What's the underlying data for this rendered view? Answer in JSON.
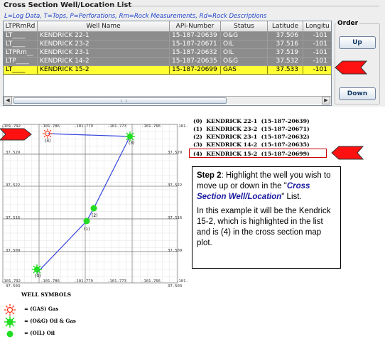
{
  "panel": {
    "title": "Cross Section Well/Location List",
    "legend": "L=Log Data, T=Tops, P=Perforations, Rm=Rock Measurements, Rd=Rock Descriptions"
  },
  "table": {
    "columns": [
      "LTPRmRd",
      "Well Name",
      "API-Number",
      "Status",
      "Latitude",
      "Longitu"
    ],
    "rows": [
      {
        "flags": "LT____",
        "name": "KENDRICK 22-1",
        "api": "15-187-20639",
        "status": "O&G",
        "lat": "37.506",
        "lon": "-101"
      },
      {
        "flags": "LT____",
        "name": "KENDRICK 23-2",
        "api": "15-187-20671",
        "status": "OIL",
        "lat": "37.516",
        "lon": "-101"
      },
      {
        "flags": "LTPRm__",
        "name": "KENDRICK 23-1",
        "api": "15-187-20632",
        "status": "OIL",
        "lat": "37.519",
        "lon": "-101"
      },
      {
        "flags": "LTP____",
        "name": "KENDRICK 14-2",
        "api": "15-187-20635",
        "status": "O&G",
        "lat": "37.532",
        "lon": "-101"
      },
      {
        "flags": "LT____",
        "name": "KENDRICK 15-2",
        "api": "15-187-20699",
        "status": "GAS",
        "lat": "37.533",
        "lon": "-101"
      }
    ],
    "selected_index": 4,
    "colors": {
      "row_bg": "#8c8c8c",
      "selected_bg": "#ffff33"
    }
  },
  "order": {
    "label": "Order",
    "up": "Up",
    "down": "Down"
  },
  "scroll": {
    "left_arrow": "◀",
    "right_arrow": "▶",
    "grip": "|||"
  },
  "plot": {
    "top_ticks": [
      "-101.792",
      "-101.786",
      "-101.779",
      "-101.773",
      "-101.766",
      "-101.76"
    ],
    "bottom_ticks": [
      "-101.792",
      "-101.786",
      "-101.779",
      "-101.773",
      "-101.766",
      "-101.76"
    ],
    "lat_ticks": [
      "37.529",
      "37.522",
      "37.516",
      "37.509",
      "37.503"
    ],
    "lat_ticks_right": [
      "37.529",
      "37.522",
      "37.516",
      "37.509",
      "37.503"
    ],
    "well_labels": [
      "(0)",
      "(1)",
      "(2)",
      "(3)",
      "(4)"
    ]
  },
  "well_list": [
    "(0)  KENDRICK 22-1  (15-187-20639)",
    "(1)  KENDRICK 23-2  (15-187-20671)",
    "(2)  KENDRICK 23-1  (15-187-20632)",
    "(3)  KENDRICK 14-2  (15-187-20635)",
    "(4)  KENDRICK 15-2  (15-187-20699)"
  ],
  "step": {
    "bold": "Step 2",
    "text1": ": Highlight the well you wish to move up or down in the \"",
    "highlight": "Cross Section Well/Location",
    "text2": "\" List.",
    "para2": "In this example it will be the Kendrick 15-2, which is highlighted in the list and is (4) in the cross section map plot."
  },
  "symbols": {
    "title": "WELL SYMBOLS",
    "items": [
      "= (GAS) Gas",
      "= (O&G) Oil & Gas",
      "= (OIL) Oil"
    ]
  }
}
